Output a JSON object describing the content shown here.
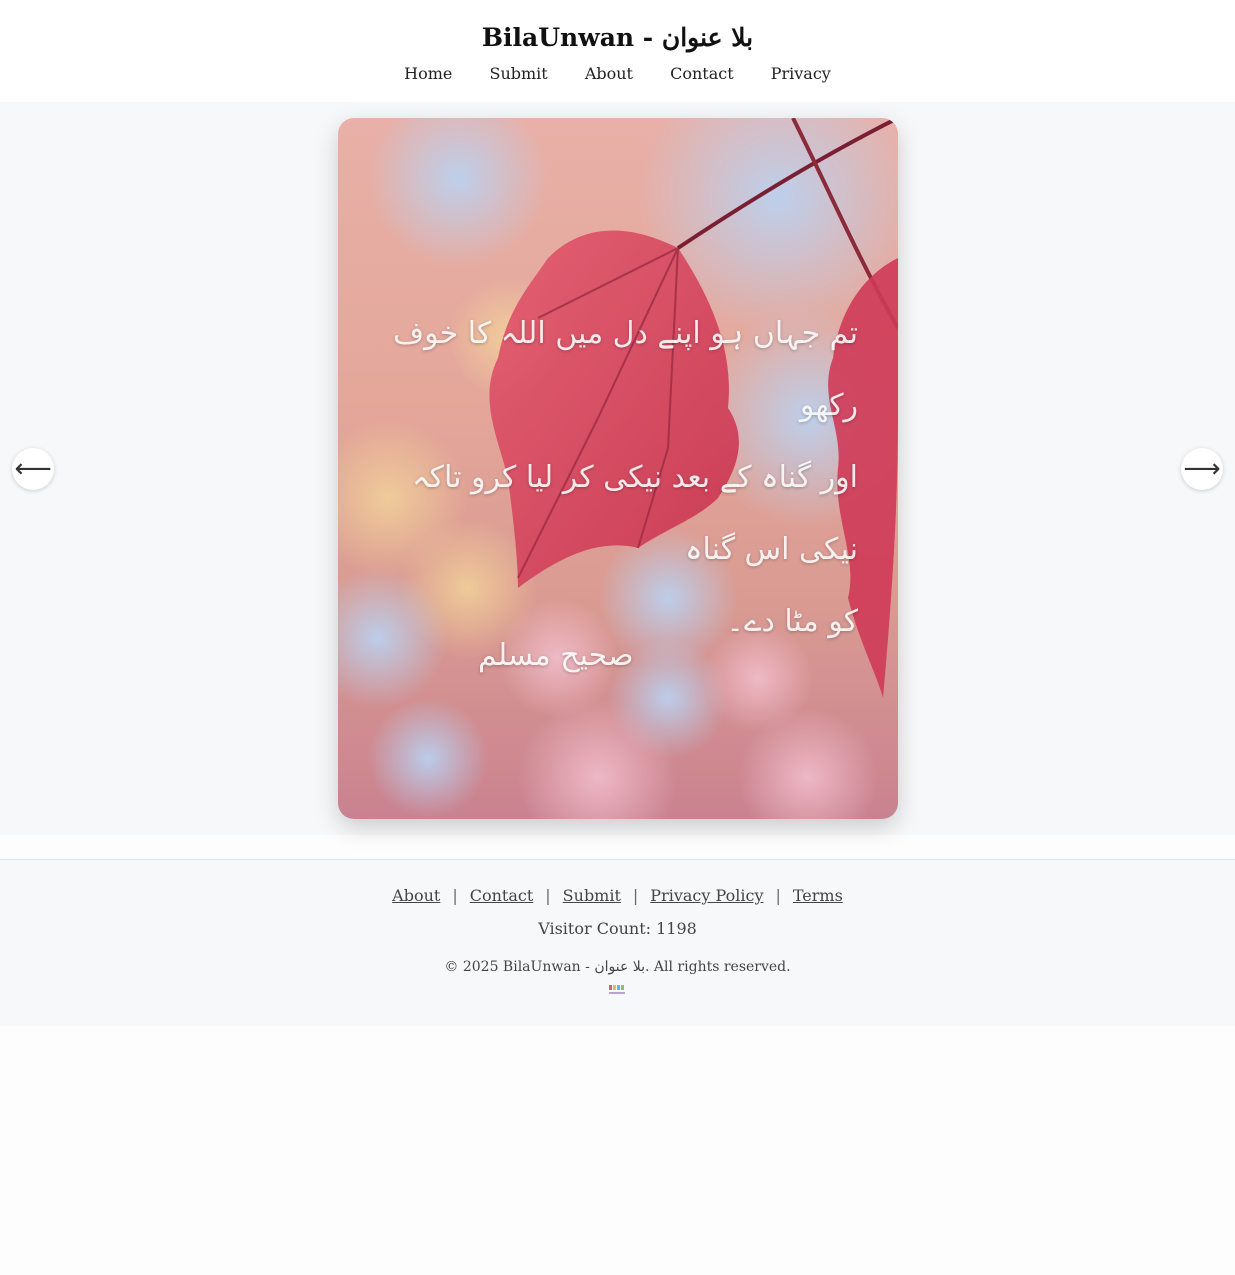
{
  "site": {
    "title": "BilaUnwan - بلا عنوان"
  },
  "nav": {
    "items": [
      "Home",
      "Submit",
      "About",
      "Contact",
      "Privacy"
    ]
  },
  "viewer": {
    "prev_arrow": "⟵",
    "next_arrow": "⟶",
    "quote_lines": [
      "تم جہاں ہو اپنے دل میں اللہ کا خوف رکھو",
      "اور گناہ کے بعد نیکی کر لیا کرو تاکہ نیکی اس گناہ",
      "کو مٹا دے۔"
    ],
    "source": "صحیح مسلم"
  },
  "footer": {
    "links": [
      "About",
      "Contact",
      "Submit",
      "Privacy Policy",
      "Terms"
    ],
    "separator": "|",
    "visitor_count": "Visitor Count: 1198",
    "copyright": "© 2025 BilaUnwan - بلا عنوان. All rights reserved."
  }
}
